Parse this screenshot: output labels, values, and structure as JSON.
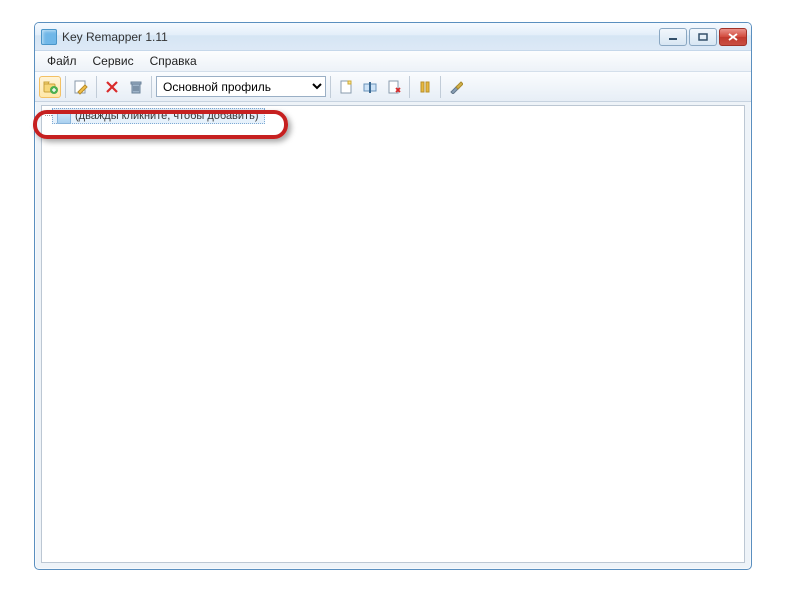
{
  "window": {
    "title": "Key Remapper 1.11"
  },
  "menu": {
    "file": "Файл",
    "service": "Сервис",
    "help": "Справка"
  },
  "toolbar": {
    "profile_selected": "Основной профиль"
  },
  "content": {
    "add_hint": "(дважды кликните, чтобы добавить)"
  }
}
